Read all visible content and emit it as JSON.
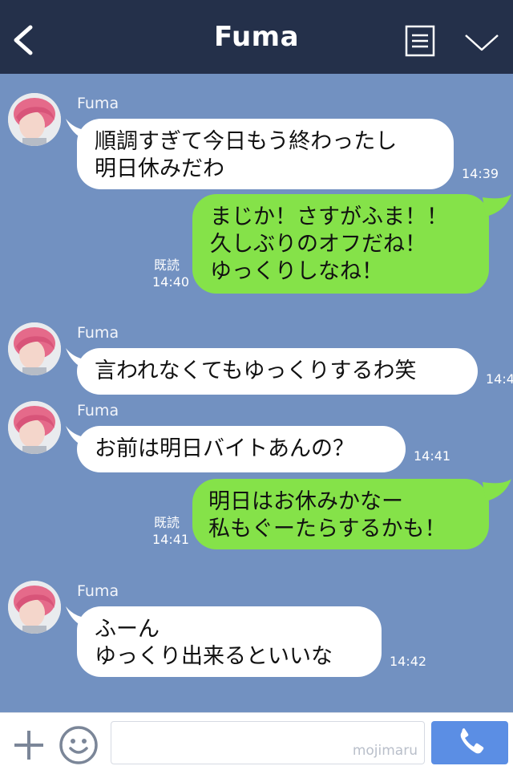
{
  "header": {
    "title": "Fuma",
    "bg_color": "#24304a",
    "icons": [
      "back-icon",
      "menu-icon",
      "chevron-down-icon"
    ]
  },
  "chat_bg_color": "#7291c1",
  "messages": [
    {
      "side": "left",
      "sender": "Fuma",
      "lines": [
        "順調すぎて今日もう終わったし",
        "明日休みだわ"
      ],
      "time": "14:39"
    },
    {
      "side": "right",
      "lines": [
        "まじか！さすがふま！！",
        "久しぶりのオフだね！",
        "ゆっくりしなね！"
      ],
      "read": "既読",
      "time": "14:40"
    },
    {
      "side": "left",
      "sender": "Fuma",
      "lines": [
        "言われなくてもゆっくりするわ笑"
      ],
      "time": "14:4"
    },
    {
      "side": "left",
      "sender": "Fuma",
      "lines": [
        "お前は明日バイトあんの？"
      ],
      "time": "14:41"
    },
    {
      "side": "right",
      "lines": [
        "明日はお休みかなー",
        "私もぐーたらするかも！"
      ],
      "read": "既読",
      "time": "14:41"
    },
    {
      "side": "left",
      "sender": "Fuma",
      "lines": [
        "ふーん",
        "ゆっくり出来るといいな"
      ],
      "time": "14:42"
    }
  ],
  "footer": {
    "input_value": "",
    "watermark": "mojimaru",
    "icons": [
      "plus-icon",
      "smile-icon",
      "phone-icon"
    ],
    "call_color": "#5b8ee4"
  },
  "colors": {
    "left_bubble": "#ffffff",
    "right_bubble": "#85e249"
  }
}
